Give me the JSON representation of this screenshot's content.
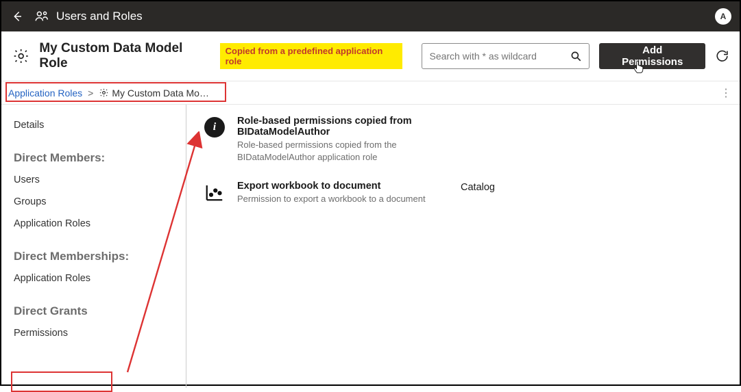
{
  "topbar": {
    "title": "Users and Roles",
    "avatar_initial": "A"
  },
  "subheader": {
    "role_name": "My Custom Data Model Role",
    "highlight_note": "Copied from a predefined application role",
    "search_placeholder": "Search with * as wildcard",
    "add_permissions_label": "Add Permissions"
  },
  "breadcrumb": {
    "root": "Application Roles",
    "current": "My Custom Data Mo…"
  },
  "sidenav": {
    "details": "Details",
    "section_members": "Direct Members:",
    "users": "Users",
    "groups": "Groups",
    "app_roles": "Application Roles",
    "section_memberships": "Direct Memberships:",
    "app_roles2": "Application Roles",
    "section_grants": "Direct Grants",
    "permissions": "Permissions"
  },
  "permissions": [
    {
      "title": "Role-based permissions copied from BIDataModelAuthor",
      "desc": "Role-based permissions copied from the BIDataModelAuthor application role",
      "category": ""
    },
    {
      "title": "Export workbook to document",
      "desc": "Permission to export a workbook to a document",
      "category": "Catalog"
    }
  ]
}
